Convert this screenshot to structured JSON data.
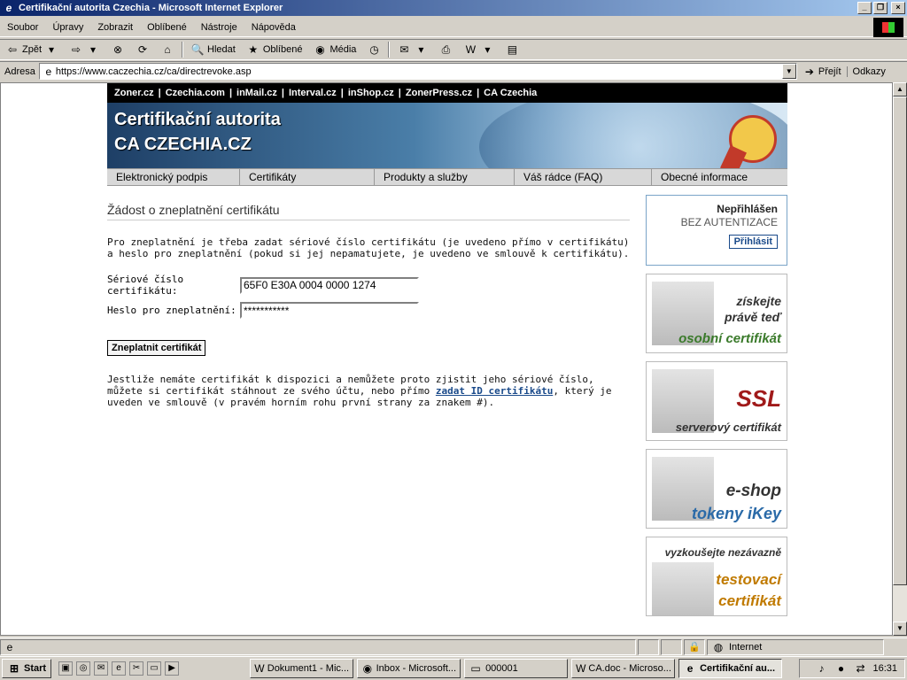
{
  "window": {
    "title": "Certifikační autorita Czechia - Microsoft Internet Explorer"
  },
  "menu": [
    "Soubor",
    "Úpravy",
    "Zobrazit",
    "Oblíbené",
    "Nástroje",
    "Nápověda"
  ],
  "toolbar": {
    "back": "Zpět",
    "search": "Hledat",
    "favorites": "Oblíbené",
    "media": "Média"
  },
  "address": {
    "label": "Adresa",
    "url": "https://www.caczechia.cz/ca/directrevoke.asp",
    "go": "Přejít",
    "links": "Odkazy"
  },
  "page": {
    "topnav": [
      "Zoner.cz",
      "Czechia.com",
      "inMail.cz",
      "Interval.cz",
      "inShop.cz",
      "ZonerPress.cz",
      "CA Czechia"
    ],
    "banner": {
      "line1": "Certifikační autorita",
      "line2": "CA CZECHIA.CZ"
    },
    "subnav": [
      "Elektronický podpis",
      "Certifikáty",
      "Produkty a služby",
      "Váš rádce (FAQ)",
      "Obecné informace"
    ],
    "heading": "Žádost o zneplatnění certifikátu",
    "intro": "Pro zneplatnění je třeba zadat sériové číslo certifikátu (je uvedeno přímo v certifikátu) a heslo pro zneplatnění (pokud si jej nepamatujete, je uvedeno ve smlouvě k certifikátu).",
    "serial_label": "Sériové číslo certifikátu:",
    "serial_value": "65F0 E30A 0004 0000 1274",
    "password_label": "Heslo pro zneplatnění:",
    "password_value": "***********",
    "submit": "Zneplatnit certifikát",
    "note_before": "Jestliže nemáte certifikát k dispozici a nemůžete proto zjistit jeho sériové číslo, můžete si certifikát stáhnout ze svého účtu, nebo přímo ",
    "note_link": "zadat ID certifikátu",
    "note_after": ", který je uveden ve smlouvě (v pravém horním rohu první strany za znakem #)."
  },
  "sidebar": {
    "login": {
      "status": "Nepřihlášen",
      "auth": "BEZ AUTENTIZACE",
      "button": "Přihlásit"
    },
    "ads": [
      {
        "lines": [
          "získejte",
          "právě teď",
          "osobní certifikát"
        ]
      },
      {
        "lines": [
          "SSL",
          "serverový certifikát"
        ]
      },
      {
        "lines": [
          "e-shop",
          "tokeny iKey"
        ]
      },
      {
        "lines": [
          "vyzkoušejte nezávazně",
          "testovací",
          "certifikát"
        ]
      }
    ]
  },
  "statusbar": {
    "zone": "Internet"
  },
  "taskbar": {
    "start": "Start",
    "tasks": [
      "Dokument1 - Mic...",
      "Inbox - Microsoft...",
      "000001",
      "CA.doc - Microso...",
      "Certifikační au..."
    ],
    "clock": "16:31"
  }
}
